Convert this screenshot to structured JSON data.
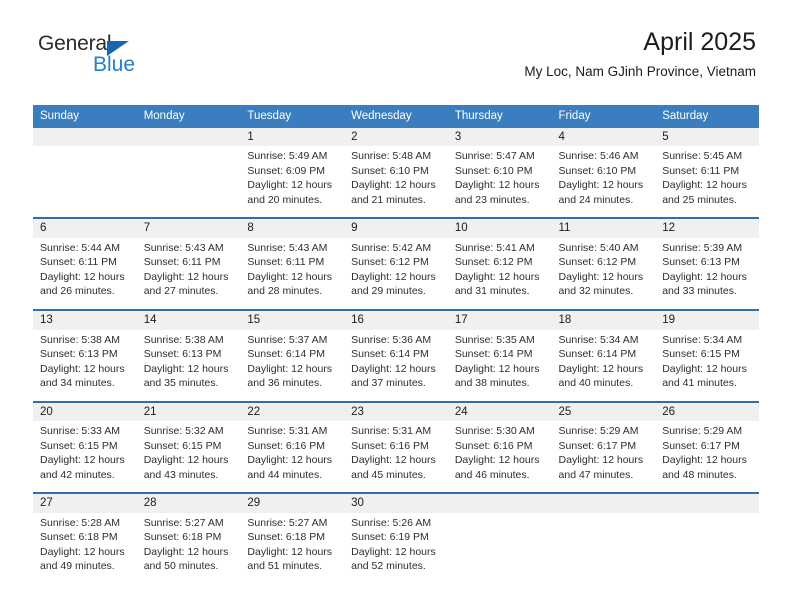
{
  "brand": {
    "name_top": "General",
    "name_bottom": "Blue",
    "triangle_color": "#1567b2",
    "blue_color": "#1f7fd0"
  },
  "header": {
    "title": "April 2025",
    "subtitle": "My Loc, Nam GJinh Province, Vietnam"
  },
  "colors": {
    "header_blue": "#3b7ebf",
    "row_divider_blue": "#2f6fac",
    "daynum_band": "#f0f0f0",
    "text": "#2e2e2e"
  },
  "weekdays": [
    "Sunday",
    "Monday",
    "Tuesday",
    "Wednesday",
    "Thursday",
    "Friday",
    "Saturday"
  ],
  "weeks": [
    {
      "days": [
        {
          "num": "",
          "sunrise": "",
          "sunset": "",
          "daylight_line1": "",
          "daylight_line2": ""
        },
        {
          "num": "",
          "sunrise": "",
          "sunset": "",
          "daylight_line1": "",
          "daylight_line2": ""
        },
        {
          "num": "1",
          "sunrise": "Sunrise: 5:49 AM",
          "sunset": "Sunset: 6:09 PM",
          "daylight_line1": "Daylight: 12 hours",
          "daylight_line2": "and 20 minutes."
        },
        {
          "num": "2",
          "sunrise": "Sunrise: 5:48 AM",
          "sunset": "Sunset: 6:10 PM",
          "daylight_line1": "Daylight: 12 hours",
          "daylight_line2": "and 21 minutes."
        },
        {
          "num": "3",
          "sunrise": "Sunrise: 5:47 AM",
          "sunset": "Sunset: 6:10 PM",
          "daylight_line1": "Daylight: 12 hours",
          "daylight_line2": "and 23 minutes."
        },
        {
          "num": "4",
          "sunrise": "Sunrise: 5:46 AM",
          "sunset": "Sunset: 6:10 PM",
          "daylight_line1": "Daylight: 12 hours",
          "daylight_line2": "and 24 minutes."
        },
        {
          "num": "5",
          "sunrise": "Sunrise: 5:45 AM",
          "sunset": "Sunset: 6:11 PM",
          "daylight_line1": "Daylight: 12 hours",
          "daylight_line2": "and 25 minutes."
        }
      ]
    },
    {
      "days": [
        {
          "num": "6",
          "sunrise": "Sunrise: 5:44 AM",
          "sunset": "Sunset: 6:11 PM",
          "daylight_line1": "Daylight: 12 hours",
          "daylight_line2": "and 26 minutes."
        },
        {
          "num": "7",
          "sunrise": "Sunrise: 5:43 AM",
          "sunset": "Sunset: 6:11 PM",
          "daylight_line1": "Daylight: 12 hours",
          "daylight_line2": "and 27 minutes."
        },
        {
          "num": "8",
          "sunrise": "Sunrise: 5:43 AM",
          "sunset": "Sunset: 6:11 PM",
          "daylight_line1": "Daylight: 12 hours",
          "daylight_line2": "and 28 minutes."
        },
        {
          "num": "9",
          "sunrise": "Sunrise: 5:42 AM",
          "sunset": "Sunset: 6:12 PM",
          "daylight_line1": "Daylight: 12 hours",
          "daylight_line2": "and 29 minutes."
        },
        {
          "num": "10",
          "sunrise": "Sunrise: 5:41 AM",
          "sunset": "Sunset: 6:12 PM",
          "daylight_line1": "Daylight: 12 hours",
          "daylight_line2": "and 31 minutes."
        },
        {
          "num": "11",
          "sunrise": "Sunrise: 5:40 AM",
          "sunset": "Sunset: 6:12 PM",
          "daylight_line1": "Daylight: 12 hours",
          "daylight_line2": "and 32 minutes."
        },
        {
          "num": "12",
          "sunrise": "Sunrise: 5:39 AM",
          "sunset": "Sunset: 6:13 PM",
          "daylight_line1": "Daylight: 12 hours",
          "daylight_line2": "and 33 minutes."
        }
      ]
    },
    {
      "days": [
        {
          "num": "13",
          "sunrise": "Sunrise: 5:38 AM",
          "sunset": "Sunset: 6:13 PM",
          "daylight_line1": "Daylight: 12 hours",
          "daylight_line2": "and 34 minutes."
        },
        {
          "num": "14",
          "sunrise": "Sunrise: 5:38 AM",
          "sunset": "Sunset: 6:13 PM",
          "daylight_line1": "Daylight: 12 hours",
          "daylight_line2": "and 35 minutes."
        },
        {
          "num": "15",
          "sunrise": "Sunrise: 5:37 AM",
          "sunset": "Sunset: 6:14 PM",
          "daylight_line1": "Daylight: 12 hours",
          "daylight_line2": "and 36 minutes."
        },
        {
          "num": "16",
          "sunrise": "Sunrise: 5:36 AM",
          "sunset": "Sunset: 6:14 PM",
          "daylight_line1": "Daylight: 12 hours",
          "daylight_line2": "and 37 minutes."
        },
        {
          "num": "17",
          "sunrise": "Sunrise: 5:35 AM",
          "sunset": "Sunset: 6:14 PM",
          "daylight_line1": "Daylight: 12 hours",
          "daylight_line2": "and 38 minutes."
        },
        {
          "num": "18",
          "sunrise": "Sunrise: 5:34 AM",
          "sunset": "Sunset: 6:14 PM",
          "daylight_line1": "Daylight: 12 hours",
          "daylight_line2": "and 40 minutes."
        },
        {
          "num": "19",
          "sunrise": "Sunrise: 5:34 AM",
          "sunset": "Sunset: 6:15 PM",
          "daylight_line1": "Daylight: 12 hours",
          "daylight_line2": "and 41 minutes."
        }
      ]
    },
    {
      "days": [
        {
          "num": "20",
          "sunrise": "Sunrise: 5:33 AM",
          "sunset": "Sunset: 6:15 PM",
          "daylight_line1": "Daylight: 12 hours",
          "daylight_line2": "and 42 minutes."
        },
        {
          "num": "21",
          "sunrise": "Sunrise: 5:32 AM",
          "sunset": "Sunset: 6:15 PM",
          "daylight_line1": "Daylight: 12 hours",
          "daylight_line2": "and 43 minutes."
        },
        {
          "num": "22",
          "sunrise": "Sunrise: 5:31 AM",
          "sunset": "Sunset: 6:16 PM",
          "daylight_line1": "Daylight: 12 hours",
          "daylight_line2": "and 44 minutes."
        },
        {
          "num": "23",
          "sunrise": "Sunrise: 5:31 AM",
          "sunset": "Sunset: 6:16 PM",
          "daylight_line1": "Daylight: 12 hours",
          "daylight_line2": "and 45 minutes."
        },
        {
          "num": "24",
          "sunrise": "Sunrise: 5:30 AM",
          "sunset": "Sunset: 6:16 PM",
          "daylight_line1": "Daylight: 12 hours",
          "daylight_line2": "and 46 minutes."
        },
        {
          "num": "25",
          "sunrise": "Sunrise: 5:29 AM",
          "sunset": "Sunset: 6:17 PM",
          "daylight_line1": "Daylight: 12 hours",
          "daylight_line2": "and 47 minutes."
        },
        {
          "num": "26",
          "sunrise": "Sunrise: 5:29 AM",
          "sunset": "Sunset: 6:17 PM",
          "daylight_line1": "Daylight: 12 hours",
          "daylight_line2": "and 48 minutes."
        }
      ]
    },
    {
      "days": [
        {
          "num": "27",
          "sunrise": "Sunrise: 5:28 AM",
          "sunset": "Sunset: 6:18 PM",
          "daylight_line1": "Daylight: 12 hours",
          "daylight_line2": "and 49 minutes."
        },
        {
          "num": "28",
          "sunrise": "Sunrise: 5:27 AM",
          "sunset": "Sunset: 6:18 PM",
          "daylight_line1": "Daylight: 12 hours",
          "daylight_line2": "and 50 minutes."
        },
        {
          "num": "29",
          "sunrise": "Sunrise: 5:27 AM",
          "sunset": "Sunset: 6:18 PM",
          "daylight_line1": "Daylight: 12 hours",
          "daylight_line2": "and 51 minutes."
        },
        {
          "num": "30",
          "sunrise": "Sunrise: 5:26 AM",
          "sunset": "Sunset: 6:19 PM",
          "daylight_line1": "Daylight: 12 hours",
          "daylight_line2": "and 52 minutes."
        },
        {
          "num": "",
          "sunrise": "",
          "sunset": "",
          "daylight_line1": "",
          "daylight_line2": ""
        },
        {
          "num": "",
          "sunrise": "",
          "sunset": "",
          "daylight_line1": "",
          "daylight_line2": ""
        },
        {
          "num": "",
          "sunrise": "",
          "sunset": "",
          "daylight_line1": "",
          "daylight_line2": ""
        }
      ]
    }
  ]
}
